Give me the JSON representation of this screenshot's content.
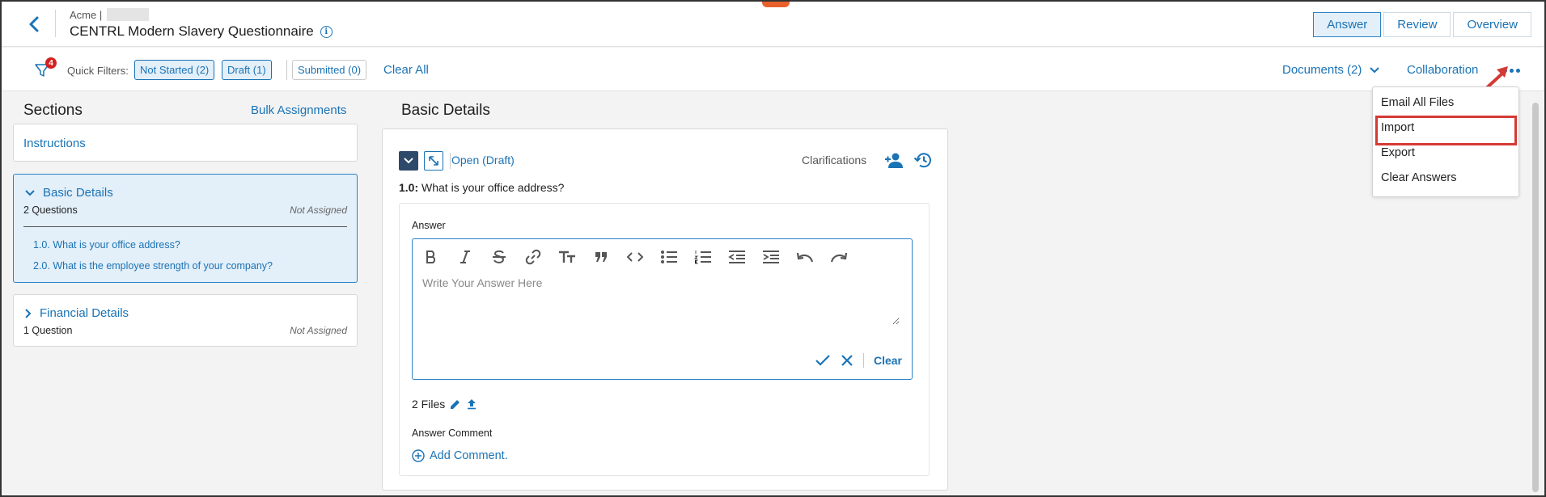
{
  "header": {
    "org": "Acme |",
    "title": "CENTRL Modern Slavery Questionnaire",
    "tabs": [
      "Answer",
      "Review",
      "Overview"
    ],
    "active_tab": "Answer"
  },
  "filters": {
    "badge_count": "4",
    "label": "Quick Filters:",
    "chips": [
      "Not Started (2)",
      "Draft (1)",
      "Submitted (0)"
    ],
    "clear_all": "Clear All",
    "documents": "Documents (2)",
    "collaboration": "Collaboration"
  },
  "sidebar": {
    "title": "Sections",
    "bulk": "Bulk Assignments",
    "instructions": "Instructions",
    "sections": [
      {
        "name": "Basic Details",
        "count": "2 Questions",
        "assignment": "Not Assigned",
        "expanded": true,
        "questions": [
          "1.0. What is your office address?",
          "2.0. What is the employee strength of your company?"
        ]
      },
      {
        "name": "Financial Details",
        "count": "1 Question",
        "assignment": "Not Assigned",
        "expanded": false
      }
    ]
  },
  "main": {
    "section_title": "Basic Details",
    "status": "Open (Draft)",
    "clarifications": "Clarifications",
    "question_number": "1.0:",
    "question_text": "What is your office address?",
    "answer_label": "Answer",
    "answer_placeholder": "Write Your Answer Here",
    "answer_value": "",
    "clear": "Clear",
    "files": "2 Files",
    "comment_label": "Answer Comment",
    "add_comment": "Add Comment."
  },
  "menu": {
    "items": [
      "Email All Files",
      "Import",
      "Export",
      "Clear Answers"
    ],
    "highlighted": "Import"
  },
  "colors": {
    "accent": "#1a73b5",
    "highlight": "#d43a35",
    "badge": "#d32020",
    "brand_orange": "#e8612c"
  }
}
